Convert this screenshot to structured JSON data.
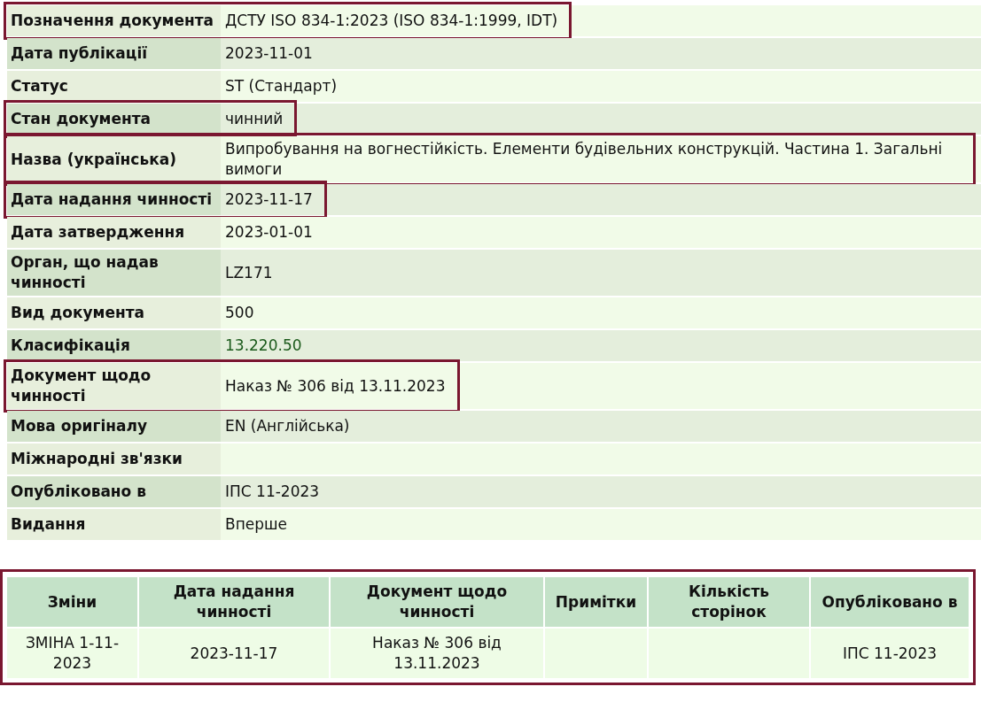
{
  "document_details": [
    {
      "label": "Позначення документа",
      "value": "ДСТУ ISO 834-1:2023 (ISO 834-1:1999, IDT)",
      "kind": "text",
      "highlighted": true
    },
    {
      "label": "Дата публікації",
      "value": "2023-11-01",
      "kind": "text",
      "highlighted": false
    },
    {
      "label": "Статус",
      "value": "ST (Стандарт)",
      "kind": "text",
      "highlighted": false
    },
    {
      "label": "Стан документа",
      "value": "чинний",
      "kind": "text",
      "highlighted": true
    },
    {
      "label": "Назва (українська)",
      "value": "Випробування на вогнестійкість. Елементи будівельних конструкцій. Частина 1. Загальні вимоги",
      "kind": "text",
      "highlighted": true
    },
    {
      "label": "Дата надання чинності",
      "value": "2023-11-17",
      "kind": "text",
      "highlighted": true
    },
    {
      "label": "Дата затвердження",
      "value": "2023-01-01",
      "kind": "text",
      "highlighted": false
    },
    {
      "label": "Орган, що надав чинності",
      "value": "LZ171",
      "kind": "text",
      "highlighted": false
    },
    {
      "label": "Вид документа",
      "value": "500",
      "kind": "text",
      "highlighted": false
    },
    {
      "label": "Класифікація",
      "value": "13.220.50",
      "kind": "link",
      "highlighted": false
    },
    {
      "label": "Документ щодо чинності",
      "value": "Наказ № 306 від 13.11.2023",
      "kind": "text",
      "highlighted": true
    },
    {
      "label": "Мова оригіналу",
      "value": "EN (Англійська)",
      "kind": "text",
      "highlighted": false
    },
    {
      "label": "Міжнародні зв'язки",
      "kind": "text",
      "highlighted": false
    },
    {
      "label": "Опубліковано в",
      "value": "ІПС 11-2023",
      "kind": "text",
      "highlighted": false
    },
    {
      "label": "Видання",
      "value": "Вперше",
      "kind": "text",
      "highlighted": false
    }
  ],
  "changes_table": {
    "highlighted": true,
    "columns": [
      "Зміни",
      "Дата надання чинності",
      "Документ щодо чинності",
      "Примітки",
      "Кількість сторінок",
      "Опубліковано в"
    ],
    "rows": [
      [
        "ЗМІНА 1-11-2023",
        "2023-11-17",
        "Наказ № 306 від 13.11.2023",
        "",
        "",
        "ІПС 11-2023"
      ]
    ]
  }
}
